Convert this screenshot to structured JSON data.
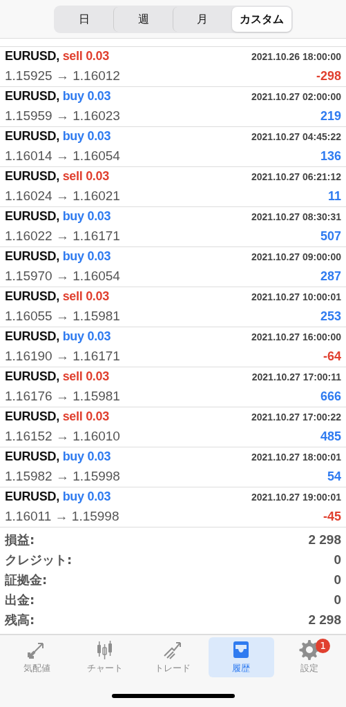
{
  "period_tabs": [
    {
      "label": "日",
      "selected": false
    },
    {
      "label": "週",
      "selected": false
    },
    {
      "label": "月",
      "selected": false
    },
    {
      "label": "カスタム",
      "selected": true
    }
  ],
  "deals": [
    {
      "symbol": "EURUSD,",
      "kind": "sell",
      "action": "sell 0.03",
      "time": "2021.10.26 18:00:00",
      "prices": "1.15925 → 1.16012",
      "profit": "-298",
      "loss": true
    },
    {
      "symbol": "EURUSD,",
      "kind": "buy",
      "action": "buy 0.03",
      "time": "2021.10.27 02:00:00",
      "prices": "1.15959 → 1.16023",
      "profit": "219",
      "loss": false
    },
    {
      "symbol": "EURUSD,",
      "kind": "buy",
      "action": "buy 0.03",
      "time": "2021.10.27 04:45:22",
      "prices": "1.16014 → 1.16054",
      "profit": "136",
      "loss": false
    },
    {
      "symbol": "EURUSD,",
      "kind": "sell",
      "action": "sell 0.03",
      "time": "2021.10.27 06:21:12",
      "prices": "1.16024 → 1.16021",
      "profit": "11",
      "loss": false
    },
    {
      "symbol": "EURUSD,",
      "kind": "buy",
      "action": "buy 0.03",
      "time": "2021.10.27 08:30:31",
      "prices": "1.16022 → 1.16171",
      "profit": "507",
      "loss": false
    },
    {
      "symbol": "EURUSD,",
      "kind": "buy",
      "action": "buy 0.03",
      "time": "2021.10.27 09:00:00",
      "prices": "1.15970 → 1.16054",
      "profit": "287",
      "loss": false
    },
    {
      "symbol": "EURUSD,",
      "kind": "sell",
      "action": "sell 0.03",
      "time": "2021.10.27 10:00:01",
      "prices": "1.16055 → 1.15981",
      "profit": "253",
      "loss": false
    },
    {
      "symbol": "EURUSD,",
      "kind": "buy",
      "action": "buy 0.03",
      "time": "2021.10.27 16:00:00",
      "prices": "1.16190 → 1.16171",
      "profit": "-64",
      "loss": true
    },
    {
      "symbol": "EURUSD,",
      "kind": "sell",
      "action": "sell 0.03",
      "time": "2021.10.27 17:00:11",
      "prices": "1.16176 → 1.15981",
      "profit": "666",
      "loss": false
    },
    {
      "symbol": "EURUSD,",
      "kind": "sell",
      "action": "sell 0.03",
      "time": "2021.10.27 17:00:22",
      "prices": "1.16152 → 1.16010",
      "profit": "485",
      "loss": false
    },
    {
      "symbol": "EURUSD,",
      "kind": "buy",
      "action": "buy 0.03",
      "time": "2021.10.27 18:00:01",
      "prices": "1.15982 → 1.15998",
      "profit": "54",
      "loss": false
    },
    {
      "symbol": "EURUSD,",
      "kind": "buy",
      "action": "buy 0.03",
      "time": "2021.10.27 19:00:01",
      "prices": "1.16011 → 1.15998",
      "profit": "-45",
      "loss": true
    }
  ],
  "summary": [
    {
      "label": "損益:",
      "value": "2 298"
    },
    {
      "label": "クレジット:",
      "value": "0"
    },
    {
      "label": "証拠金:",
      "value": "0"
    },
    {
      "label": "出金:",
      "value": "0"
    },
    {
      "label": "残高:",
      "value": "2 298"
    }
  ],
  "tab_bar": [
    {
      "kind": "quotes",
      "label": "気配値",
      "selected": false
    },
    {
      "kind": "chart",
      "label": "チャート",
      "selected": false
    },
    {
      "kind": "trade",
      "label": "トレード",
      "selected": false
    },
    {
      "kind": "history",
      "label": "履歴",
      "selected": true
    },
    {
      "kind": "settings",
      "label": "設定",
      "selected": false,
      "badge": "1"
    }
  ]
}
